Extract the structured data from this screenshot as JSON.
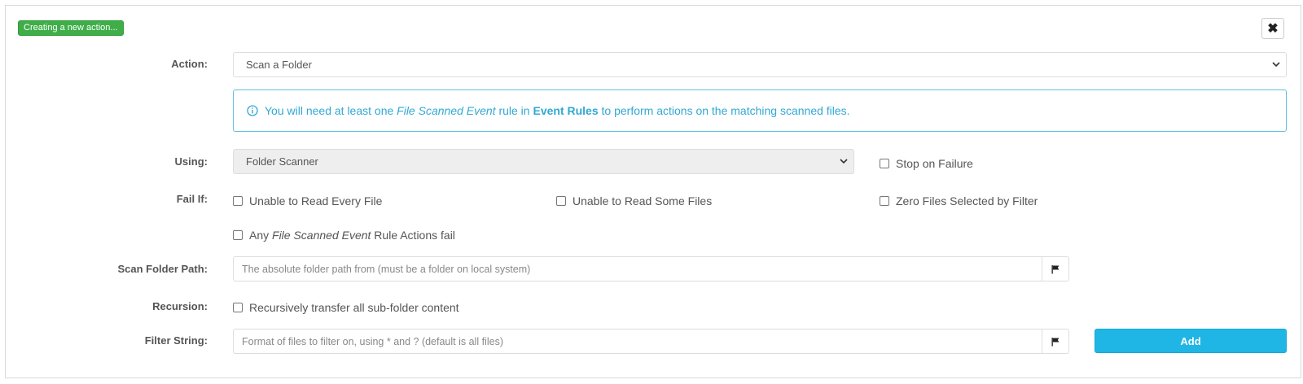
{
  "status_badge": "Creating a new action...",
  "close_icon": "close-x",
  "action": {
    "label": "Action:",
    "value": "Scan a Folder"
  },
  "info": {
    "icon": "info-circle-icon",
    "t1": "You will need at least one ",
    "t2": "File Scanned Event",
    "t3": " rule in ",
    "t4": "Event Rules",
    "t5": " to perform actions on the matching scanned files."
  },
  "using": {
    "label": "Using:",
    "value": "Folder Scanner"
  },
  "stop_on_failure": "Stop on Failure",
  "fail_if": {
    "label": "Fail If:",
    "opt1": "Unable to Read Every File",
    "opt2": "Unable to Read Some Files",
    "opt3": "Zero Files Selected by Filter",
    "opt4_a": "Any ",
    "opt4_b": "File Scanned Event",
    "opt4_c": " Rule Actions fail"
  },
  "scan_path": {
    "label": "Scan Folder Path:",
    "placeholder": "The absolute folder path from (must be a folder on local system)",
    "value": ""
  },
  "recursion": {
    "label": "Recursion:",
    "option": "Recursively transfer all sub-folder content"
  },
  "filter": {
    "label": "Filter String:",
    "placeholder": "Format of files to filter on, using * and ? (default is all files)",
    "value": ""
  },
  "add_button": "Add",
  "colors": {
    "badge": "#3fae49",
    "info": "#31a8d4",
    "add": "#1fb6e5"
  }
}
